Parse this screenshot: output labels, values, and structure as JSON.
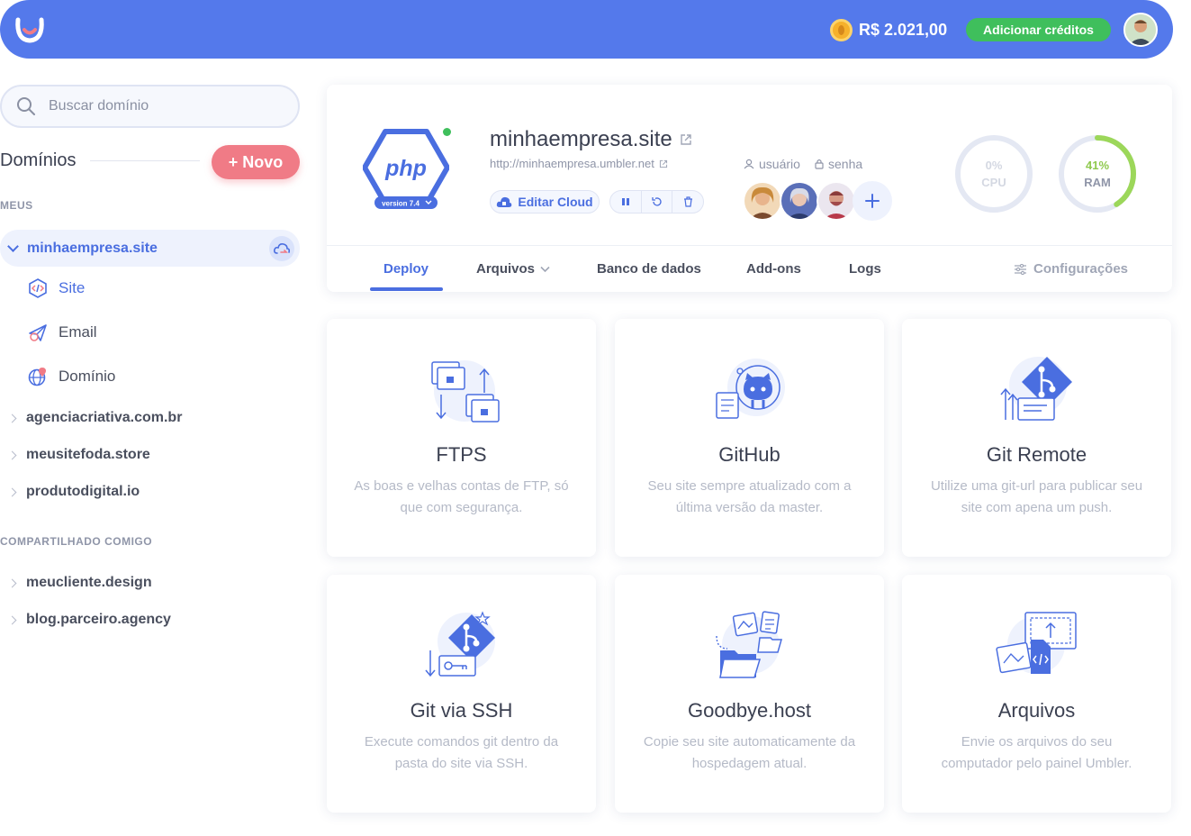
{
  "header": {
    "balance": "R$ 2.021,00",
    "add_credits_label": "Adicionar créditos",
    "icons": [
      "umbler-logo-icon",
      "coin-icon",
      "user-avatar"
    ]
  },
  "sidebar": {
    "search_placeholder": "Buscar domínio",
    "title": "Domínios",
    "new_button": "+ Novo",
    "section_mine": "MEUS",
    "active_domain": "minhaempresa.site",
    "sub_items": [
      {
        "label": "Site",
        "icon": "code-icon"
      },
      {
        "label": "Email",
        "icon": "paper-plane-icon"
      },
      {
        "label": "Domínio",
        "icon": "globe-pin-icon"
      }
    ],
    "domains": [
      "agenciacriativa.com.br",
      "meusitefoda.store",
      "produtodigital.io"
    ],
    "section_shared": "COMPARTILHADO COMIGO",
    "shared_domains": [
      "meucliente.design",
      "blog.parceiro.agency"
    ]
  },
  "site": {
    "name": "minhaempresa.site",
    "url": "http://minhaempresa.umbler.net",
    "php_label": "php",
    "php_version": "version 7.4",
    "edit_cloud": "Editar Cloud",
    "user_label": "usuário",
    "password_label": "senha",
    "cpu": {
      "value": "0%",
      "label": "CPU",
      "fraction": 0.0
    },
    "ram": {
      "value": "41%",
      "label": "RAM",
      "fraction": 0.41
    },
    "status_color": "#3fbf5c"
  },
  "tabs": [
    {
      "label": "Deploy",
      "active": true
    },
    {
      "label": "Arquivos",
      "active": false
    },
    {
      "label": "Banco de dados",
      "active": false
    },
    {
      "label": "Add-ons",
      "active": false
    },
    {
      "label": "Logs",
      "active": false
    }
  ],
  "settings_tab": "Configurações",
  "cards": [
    {
      "title": "FTPS",
      "desc": "As boas e velhas contas de FTP, só que com segurança.",
      "icon": "ftp-folders-icon"
    },
    {
      "title": "GitHub",
      "desc": "Seu site sempre atualizado com a última versão da master.",
      "icon": "github-icon"
    },
    {
      "title": "Git Remote",
      "desc": "Utilize uma git-url para publicar seu site com apena um push.",
      "icon": "git-remote-icon"
    },
    {
      "title": "Git via SSH",
      "desc": "Execute comandos git dentro da pasta do site via SSH.",
      "icon": "git-ssh-icon"
    },
    {
      "title": "Goodbye.host",
      "desc": "Copie seu site automaticamente da hospedagem atual.",
      "icon": "goodbye-host-icon"
    },
    {
      "title": "Arquivos",
      "desc": "Envie os arquivos do seu computador pelo painel Umbler.",
      "icon": "upload-files-icon"
    }
  ],
  "colors": {
    "brand": "#5479eb",
    "accent": "#4a6ee0",
    "success": "#3fbf5c",
    "danger": "#f07b86"
  }
}
